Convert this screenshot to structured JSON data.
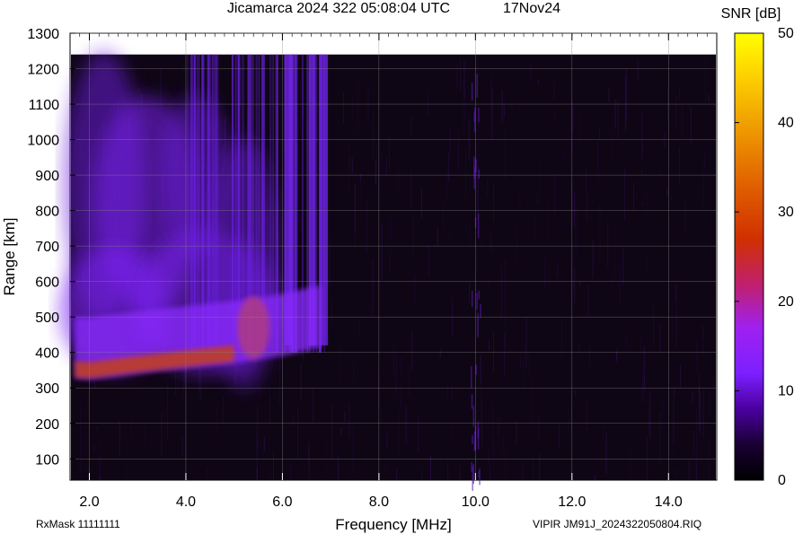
{
  "header": {
    "title": "Jicamarca 2024 322 05:08:04 UTC",
    "date": "17Nov24"
  },
  "footer": {
    "rxmask": "RxMask 11111111",
    "file": "VIPIR  JM91J_2024322050804.RIQ"
  },
  "colorbar": {
    "label": "SNR [dB]",
    "min": 0,
    "max": 50,
    "ticks": [
      "0",
      "10",
      "20",
      "30",
      "40",
      "50"
    ],
    "colors": [
      "#000000",
      "#1a0033",
      "#4b00a0",
      "#7c20ff",
      "#a020f0",
      "#c0206a",
      "#d03000",
      "#e06000",
      "#f0a000",
      "#ffd800",
      "#ffff00"
    ]
  },
  "chart_data": {
    "type": "heatmap",
    "title": "Jicamarca 2024 322 05:08:04 UTC",
    "xlabel": "Frequency [MHz]",
    "ylabel": "Range [km]",
    "xlim": [
      1.6,
      15.0
    ],
    "ylim": [
      40,
      1300
    ],
    "data_range_max": 1240,
    "x_ticks": [
      2.0,
      4.0,
      6.0,
      8.0,
      10.0,
      12.0,
      14.0
    ],
    "x_tick_labels": [
      "2.0",
      "4.0",
      "6.0",
      "8.0",
      "10.0",
      "12.0",
      "14.0"
    ],
    "y_ticks": [
      100,
      200,
      300,
      400,
      500,
      600,
      700,
      800,
      900,
      1000,
      1100,
      1200,
      1300
    ],
    "y_tick_labels": [
      "100",
      "200",
      "300",
      "400",
      "500",
      "600",
      "700",
      "800",
      "900",
      "1000",
      "1100",
      "1200",
      "1300"
    ],
    "colorbar_label": "SNR [dB]",
    "zlim": [
      0,
      50
    ],
    "grid": true,
    "features": [
      {
        "name": "F-layer trace",
        "freq": [
          1.7,
          2.0,
          3.0,
          4.0,
          5.0,
          6.0,
          6.8
        ],
        "range": [
          330,
          328,
          345,
          360,
          375,
          395,
          420
        ],
        "snr": 27
      },
      {
        "name": "diffuse upper echo",
        "freq_range": [
          1.7,
          6.0
        ],
        "range_range": [
          600,
          1000
        ],
        "snr": 12
      },
      {
        "name": "strong lines",
        "freq": [
          6.1,
          6.6,
          6.85
        ],
        "snr": 14
      }
    ]
  }
}
